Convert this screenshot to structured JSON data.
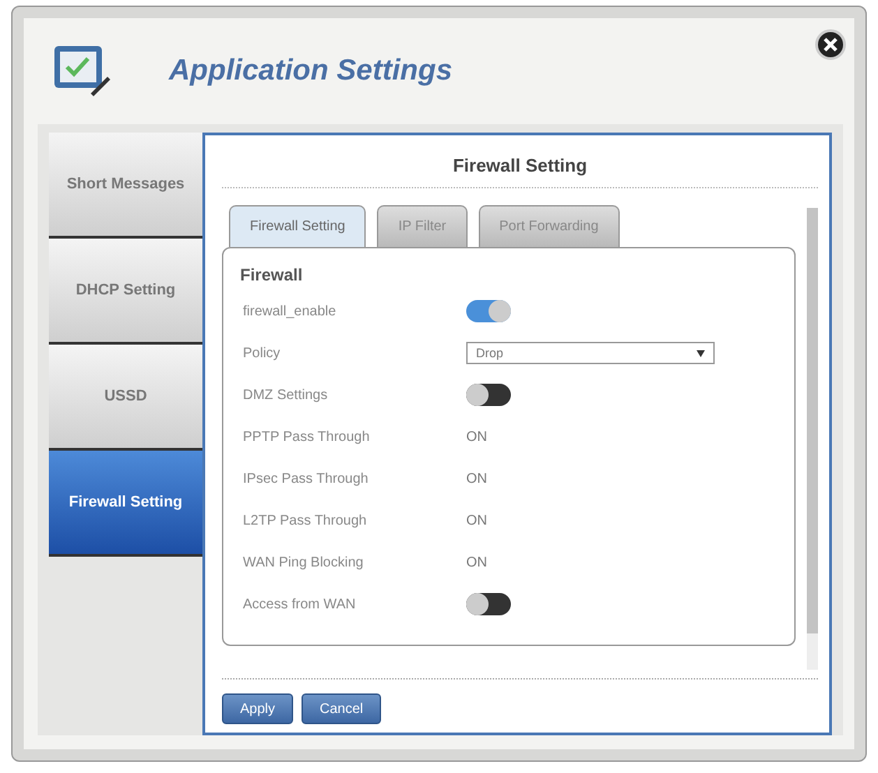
{
  "window": {
    "title": "Application Settings"
  },
  "sidebar": {
    "items": [
      {
        "label": "Short Messages",
        "selected": false
      },
      {
        "label": "DHCP Setting",
        "selected": false
      },
      {
        "label": "USSD",
        "selected": false
      },
      {
        "label": "Firewall Setting",
        "selected": true
      }
    ]
  },
  "panel": {
    "title": "Firewall Setting",
    "tabs": [
      {
        "label": "Firewall Setting",
        "selected": true
      },
      {
        "label": "IP Filter",
        "selected": false
      },
      {
        "label": "Port Forwarding",
        "selected": false
      }
    ],
    "section": "Firewall",
    "rows": [
      {
        "kind": "toggle",
        "label": "firewall_enable",
        "on": true
      },
      {
        "kind": "select",
        "label": "Policy",
        "value": "Drop"
      },
      {
        "kind": "toggle",
        "label": "DMZ Settings",
        "on": false
      },
      {
        "kind": "text",
        "label": "PPTP Pass Through",
        "value": "ON"
      },
      {
        "kind": "text",
        "label": "IPsec Pass Through",
        "value": "ON"
      },
      {
        "kind": "text",
        "label": "L2TP Pass Through",
        "value": "ON"
      },
      {
        "kind": "text",
        "label": "WAN Ping Blocking",
        "value": "ON"
      },
      {
        "kind": "toggle",
        "label": "Access from WAN",
        "on": false
      }
    ],
    "buttons": [
      "Apply",
      "Cancel"
    ]
  }
}
